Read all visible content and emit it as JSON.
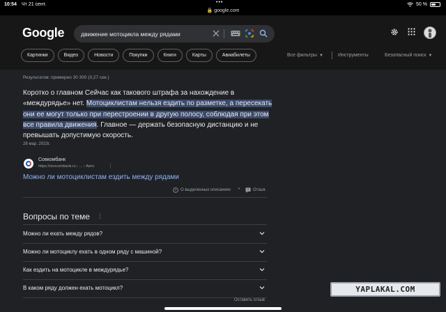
{
  "status_bar": {
    "time": "10:54",
    "date": "Чт 21 сент.",
    "url": "google.com",
    "battery": "50 %",
    "battery_level": 0.5
  },
  "header": {
    "logo": "Google",
    "query": "движение мотоцикла между рядами",
    "icons": [
      "clear-icon",
      "keyboard-icon",
      "lens-icon",
      "search-icon",
      "settings-icon",
      "apps-icon",
      "avatar"
    ]
  },
  "tabs": [
    "Картинки",
    "Видео",
    "Новости",
    "Покупки",
    "Книги",
    "Карты",
    "Авиабилеты"
  ],
  "tools": {
    "filters": "Все фильтры",
    "instruments": "Инструменты",
    "safe_search": "Безопасный поиск"
  },
  "results": {
    "count": "Результатов: примерно 30 300 (0,27 сек.)",
    "snippet_before": "Коротко о главном Сейчас как такового штрафа за нахождение в «междурядье» нет. ",
    "snippet_highlight": "Мотоциклистам нельзя ездить по разметке, а пересекать они ее могут только при перестроении в другую полосу, соблюдая при этом все правила движения",
    "snippet_after": ". Главное — держать безопасную дистанцию и не превышать допустимую скорость.",
    "date": "28 мар. 2023г.",
    "source_name": "Совкомбанк",
    "source_url": "https://sovcombank.ru › ... › Авто",
    "link_title": "Можно ли мотоциклистам ездить между рядами",
    "about_featured": "О выделенных описаниях",
    "feedback": "Отзыв"
  },
  "paa": {
    "title": "Вопросы по теме",
    "questions": [
      "Можно ли ехать между рядов?",
      "Можно ли мотоциклу ехать в одном ряду с машиной?",
      "Как ездить на мотоцикле в междурядье?",
      "В каком ряду должен ехать мотоцикл?"
    ],
    "leave_feedback": "Оставить отзыв"
  },
  "watermark": "YAPLAKAL.COM",
  "colors": {
    "background": "#202124",
    "header": "#171717",
    "link": "#8ab4f8",
    "highlight": "#3b4a6b"
  }
}
